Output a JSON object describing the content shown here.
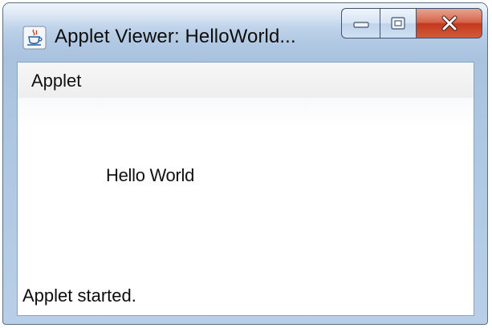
{
  "window": {
    "title": "Applet Viewer: HelloWorld...",
    "app_icon": "java-coffee-cup-icon"
  },
  "caption_buttons": {
    "minimize_icon": "minimize-icon",
    "maximize_icon": "maximize-icon",
    "close_icon": "close-icon",
    "close_color": "#c3391e"
  },
  "menubar": {
    "items": [
      {
        "label": "Applet"
      }
    ]
  },
  "applet": {
    "text": "Hello World"
  },
  "status": {
    "text": "Applet started."
  }
}
